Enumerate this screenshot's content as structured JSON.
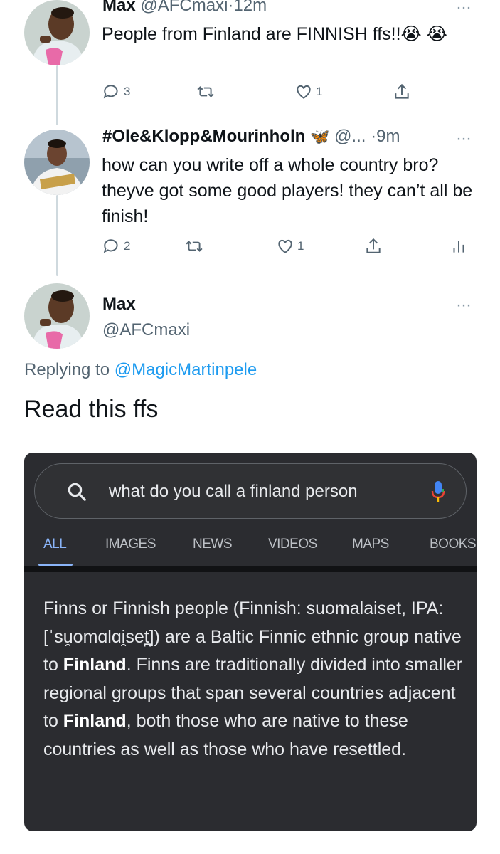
{
  "tweets": [
    {
      "name": "Max",
      "handle": "@AFCmaxi",
      "time": "12m",
      "text": "People from Finland are FINNISH ffs!!😭 😭",
      "replies": "3",
      "likes": "1"
    },
    {
      "name": "#Ole&Klopp&Mourinholn",
      "badge": "🦋",
      "handle": "@...",
      "time": "9m",
      "text": "how can you write off a whole country bro? theyve got some good players! they can’t all be finish!",
      "replies": "2",
      "likes": "1"
    }
  ],
  "main_tweet": {
    "name": "Max",
    "handle": "@AFCmaxi",
    "replying_prefix": "Replying to",
    "replying_to": "@MagicMartinpele",
    "text": "Read this ffs"
  },
  "google": {
    "query": "what do you call a finland person",
    "tabs": [
      "ALL",
      "IMAGES",
      "NEWS",
      "VIDEOS",
      "MAPS",
      "BOOKS"
    ],
    "snippet": [
      {
        "t": "Finns or Finnish people (Finnish: suomalaiset, IPA: [ˈsu̯omɑlɑi̯set̪]) are a Baltic Finnic ethnic group native to ",
        "b": false
      },
      {
        "t": "Finland",
        "b": true
      },
      {
        "t": ". Finns are traditionally divided into smaller regional groups that span several countries adjacent to ",
        "b": false
      },
      {
        "t": "Finland",
        "b": true
      },
      {
        "t": ", both those who are native to these countries as well as those who have resettled.",
        "b": false
      }
    ]
  },
  "colors": {
    "accent": "#1d9bf0",
    "text": "#0f1419",
    "muted": "#536471",
    "card_bg": "#2b2c30",
    "google_blue": "#8ab4f8"
  }
}
